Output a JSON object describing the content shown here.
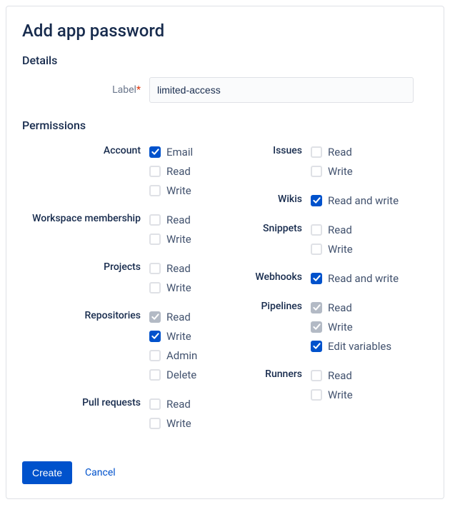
{
  "title": "Add app password",
  "details": {
    "section_title": "Details",
    "label_text": "Label",
    "required_mark": "*",
    "label_value": "limited-access"
  },
  "permissions": {
    "section_title": "Permissions",
    "left": [
      {
        "group": "Account",
        "options": [
          {
            "label": "Email",
            "state": "checked"
          },
          {
            "label": "Read",
            "state": "unchecked"
          },
          {
            "label": "Write",
            "state": "unchecked"
          }
        ]
      },
      {
        "group": "Workspace membership",
        "options": [
          {
            "label": "Read",
            "state": "unchecked"
          },
          {
            "label": "Write",
            "state": "unchecked"
          }
        ]
      },
      {
        "group": "Projects",
        "options": [
          {
            "label": "Read",
            "state": "unchecked"
          },
          {
            "label": "Write",
            "state": "unchecked"
          }
        ]
      },
      {
        "group": "Repositories",
        "options": [
          {
            "label": "Read",
            "state": "checked-disabled"
          },
          {
            "label": "Write",
            "state": "checked"
          },
          {
            "label": "Admin",
            "state": "unchecked"
          },
          {
            "label": "Delete",
            "state": "unchecked"
          }
        ]
      },
      {
        "group": "Pull requests",
        "options": [
          {
            "label": "Read",
            "state": "unchecked"
          },
          {
            "label": "Write",
            "state": "unchecked"
          }
        ]
      }
    ],
    "right": [
      {
        "group": "Issues",
        "options": [
          {
            "label": "Read",
            "state": "unchecked"
          },
          {
            "label": "Write",
            "state": "unchecked"
          }
        ]
      },
      {
        "group": "Wikis",
        "options": [
          {
            "label": "Read and write",
            "state": "checked"
          }
        ]
      },
      {
        "group": "Snippets",
        "options": [
          {
            "label": "Read",
            "state": "unchecked"
          },
          {
            "label": "Write",
            "state": "unchecked"
          }
        ]
      },
      {
        "group": "Webhooks",
        "options": [
          {
            "label": "Read and write",
            "state": "checked"
          }
        ]
      },
      {
        "group": "Pipelines",
        "options": [
          {
            "label": "Read",
            "state": "checked-disabled"
          },
          {
            "label": "Write",
            "state": "checked-disabled"
          },
          {
            "label": "Edit variables",
            "state": "checked"
          }
        ]
      },
      {
        "group": "Runners",
        "options": [
          {
            "label": "Read",
            "state": "unchecked"
          },
          {
            "label": "Write",
            "state": "unchecked"
          }
        ]
      }
    ]
  },
  "actions": {
    "create": "Create",
    "cancel": "Cancel"
  }
}
